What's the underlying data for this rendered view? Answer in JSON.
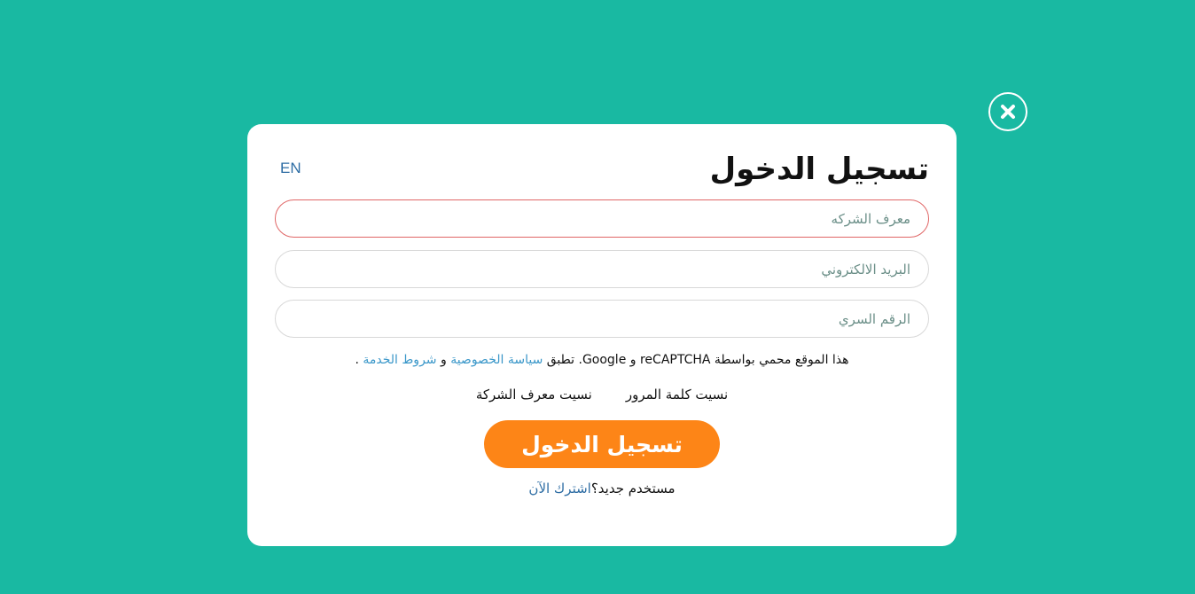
{
  "close": {
    "icon": "close-icon"
  },
  "login": {
    "title": "تسجيل الدخول",
    "lang_toggle": "EN",
    "fields": {
      "company_id_placeholder": "معرف الشركه",
      "email_placeholder": "البريد الالكتروني",
      "password_placeholder": "الرقم السري"
    },
    "recaptcha": {
      "prefix": "هذا الموقع محمي بواسطة reCAPTCHA و Google. تطبق ",
      "privacy_link": "سياسة الخصوصية",
      "and": " و ",
      "terms_link": "شروط الخدمة",
      "suffix": " ."
    },
    "forgot_password": "نسيت كلمة المرور",
    "forgot_company_id": "نسيت معرف الشركة",
    "submit_label": "تسجيل الدخول",
    "signup_prompt": "مستخدم جديد؟",
    "signup_link": "اشترك الآن"
  },
  "colors": {
    "background": "#19b9a2",
    "accent": "#fd8517",
    "link": "#3a97c9",
    "error_border": "#e06666"
  }
}
